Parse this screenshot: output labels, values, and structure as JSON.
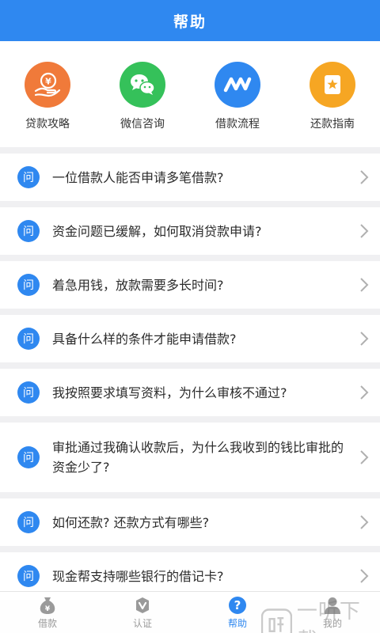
{
  "header": {
    "title": "帮助"
  },
  "quick_links": [
    {
      "label": "贷款攻略",
      "icon": "loan-guide-icon",
      "color": "#f07a3a"
    },
    {
      "label": "微信咨询",
      "icon": "wechat-icon",
      "color": "#35c15a"
    },
    {
      "label": "借款流程",
      "icon": "process-icon",
      "color": "#2f88f0"
    },
    {
      "label": "还款指南",
      "icon": "repay-guide-icon",
      "color": "#f6a623"
    }
  ],
  "faq": {
    "badge": "问",
    "items": [
      {
        "text": "一位借款人能否申请多笔借款?"
      },
      {
        "text": "资金问题已缓解，如何取消贷款申请?"
      },
      {
        "text": "着急用钱，放款需要多长时间?"
      },
      {
        "text": "具备什么样的条件才能申请借款?"
      },
      {
        "text": "我按照要求填写资料，为什么审核不通过?"
      },
      {
        "text": "审批通过我确认收款后，为什么我收到的钱比审批的资金少了?"
      },
      {
        "text": "如何还款? 还款方式有哪些?"
      },
      {
        "text": "现金帮支持哪些银行的借记卡?"
      }
    ]
  },
  "tabbar": {
    "active": "帮助",
    "items": [
      {
        "label": "借款",
        "icon": "money-bag-icon"
      },
      {
        "label": "认证",
        "icon": "verify-icon"
      },
      {
        "label": "帮助",
        "icon": "help-icon"
      },
      {
        "label": "我的",
        "icon": "profile-icon"
      }
    ]
  },
  "watermark": {
    "text": "一听下载"
  },
  "colors": {
    "primary": "#2f88f0",
    "background": "#f0f0f2"
  }
}
